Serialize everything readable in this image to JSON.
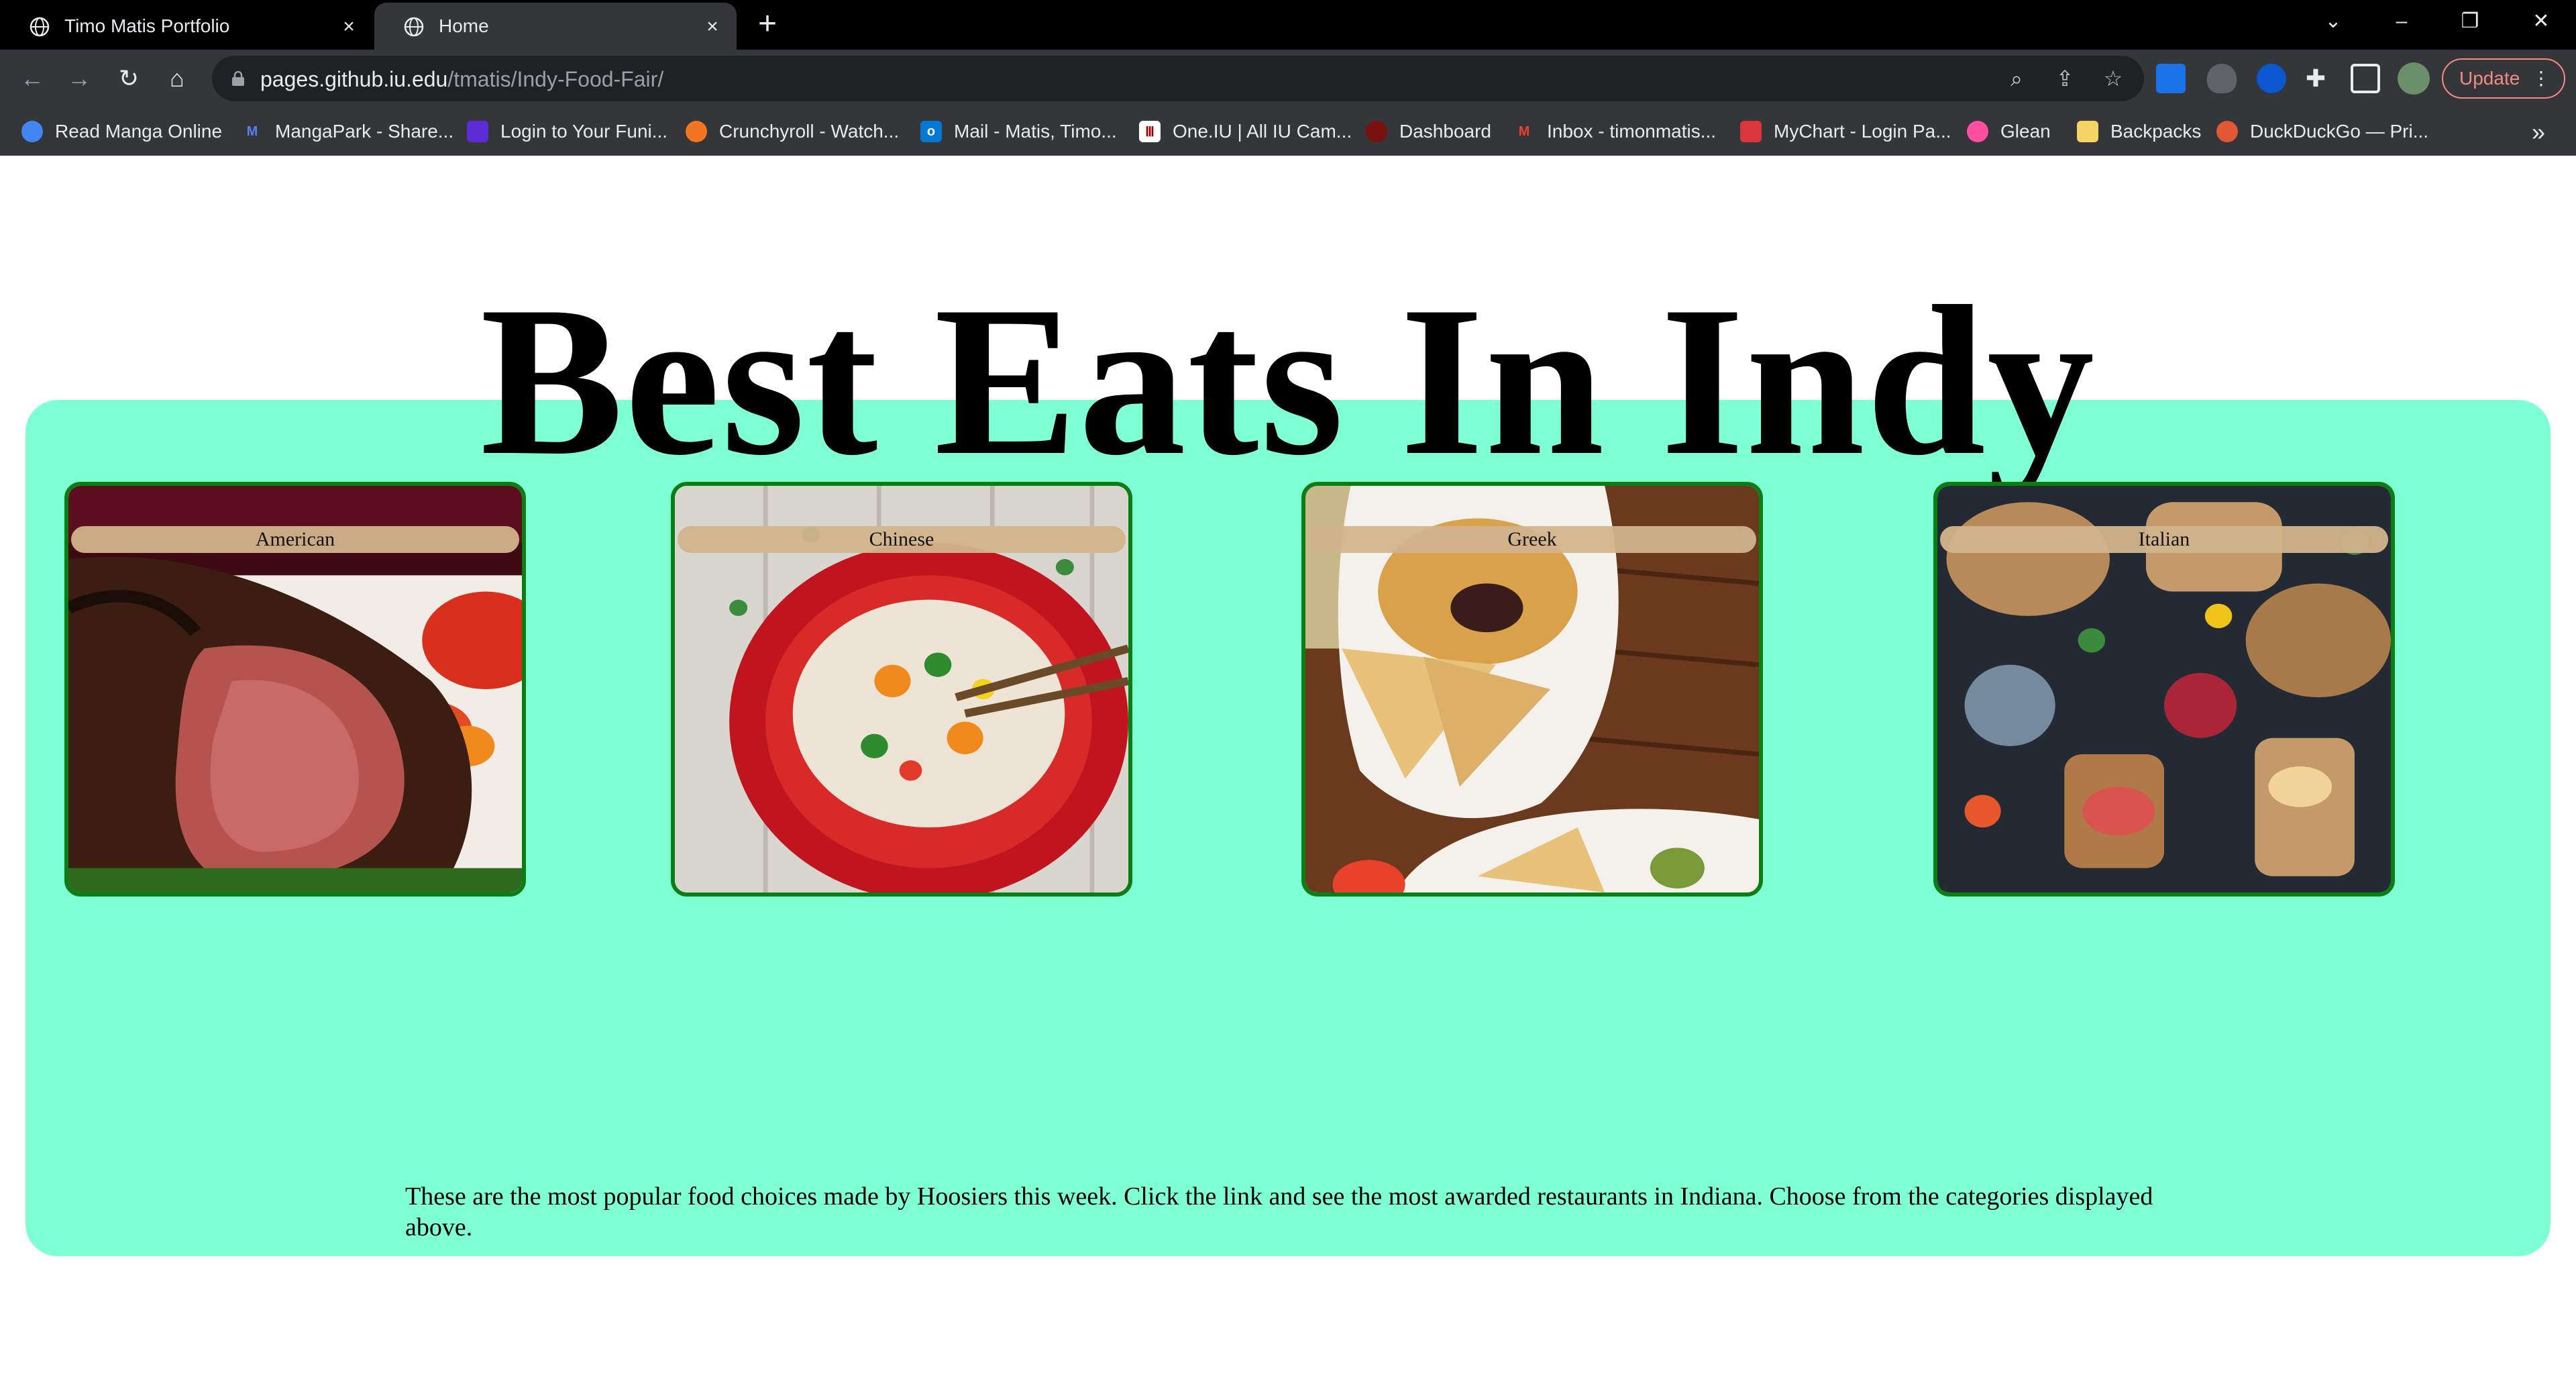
{
  "browser": {
    "tabs": [
      {
        "title": "Timo Matis Portfolio",
        "active": false
      },
      {
        "title": "Home",
        "active": true
      }
    ],
    "url_host": "pages.github.iu.edu",
    "url_path": "/tmatis/Indy-Food-Fair/",
    "update_label": "Update",
    "bookmarks": [
      {
        "label": "Read Manga Online",
        "icon": "manga-icon",
        "color": "#4285f4"
      },
      {
        "label": "MangaPark - Share...",
        "icon": "mangapark-icon",
        "color": "#3b5bdb"
      },
      {
        "label": "Login to Your Funi...",
        "icon": "funimation-icon",
        "color": "#5b2bd6"
      },
      {
        "label": "Crunchyroll - Watch...",
        "icon": "crunchyroll-icon",
        "color": "#f47521"
      },
      {
        "label": "Mail - Matis, Timo...",
        "icon": "outlook-icon",
        "color": "#0078d4"
      },
      {
        "label": "One.IU | All IU Cam...",
        "icon": "iu-icon",
        "color": "#990000"
      },
      {
        "label": "Dashboard",
        "icon": "canvas-icon",
        "color": "#7a1111"
      },
      {
        "label": "Inbox - timonmatis...",
        "icon": "gmail-icon",
        "color": "#ea4335"
      },
      {
        "label": "MyChart - Login Pa...",
        "icon": "mychart-icon",
        "color": "#d9363e"
      },
      {
        "label": "Glean",
        "icon": "glean-icon",
        "color": "#ff4fa3"
      },
      {
        "label": "Backpacks",
        "icon": "folder-icon",
        "color": "#f6d365"
      },
      {
        "label": "DuckDuckGo — Pri...",
        "icon": "duckduckgo-icon",
        "color": "#de5833"
      }
    ]
  },
  "page": {
    "heading": "Best Eats In Indy",
    "categories": [
      {
        "label": "American",
        "photo": "steak-photo"
      },
      {
        "label": "Chinese",
        "photo": "noodle-bowl-photo"
      },
      {
        "label": "Greek",
        "photo": "hummus-pita-photo"
      },
      {
        "label": "Italian",
        "photo": "antipasto-board-photo"
      }
    ],
    "description": "These are the most popular food choices made by Hoosiers this week. Click the link and see the most awarded restaurants in Indiana. Choose from the categories displayed above.",
    "colors": {
      "panel": "#7fffd4",
      "card_border": "#0b7d14",
      "caption": "#d2b48c"
    }
  }
}
